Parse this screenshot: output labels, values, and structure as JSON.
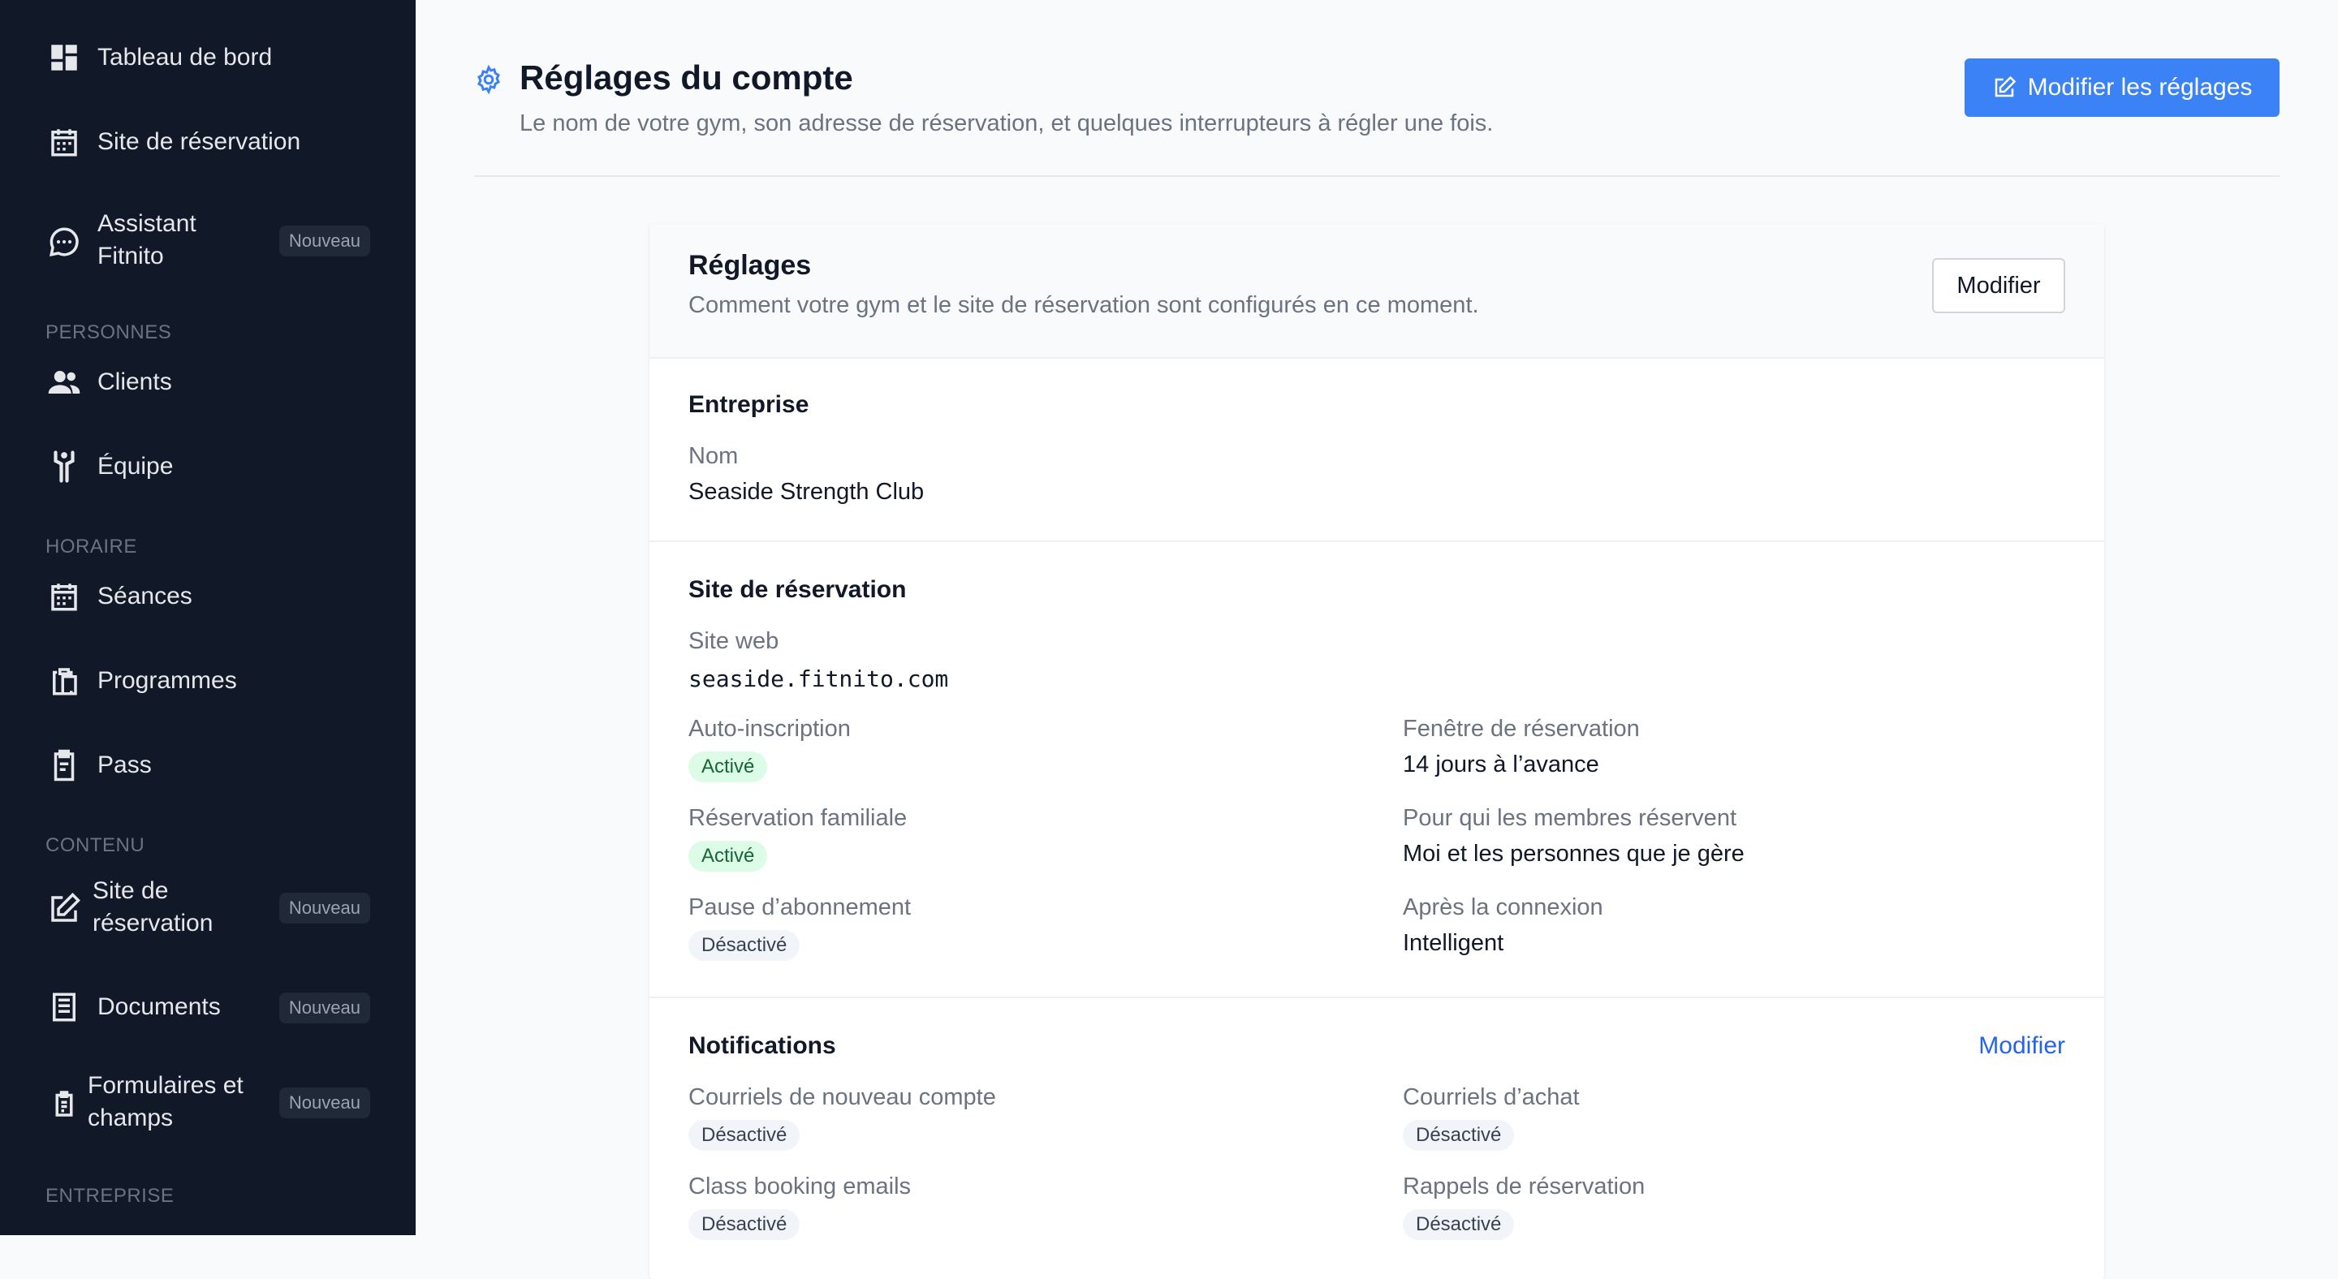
{
  "sidebar": {
    "items": [
      {
        "label": "Tableau de bord",
        "icon": "dashboard-icon"
      },
      {
        "label": "Site de réservation",
        "icon": "calendar-icon"
      },
      {
        "label": "Assistant\nFitnito",
        "icon": "chat-icon",
        "badge": "Nouveau"
      }
    ],
    "sections": [
      {
        "title": "PERSONNES",
        "items": [
          {
            "label": "Clients",
            "icon": "users-icon"
          },
          {
            "label": "Équipe",
            "icon": "person-arms-up-icon"
          }
        ]
      },
      {
        "title": "HORAIRE",
        "items": [
          {
            "label": "Séances",
            "icon": "calendar-icon"
          },
          {
            "label": "Programmes",
            "icon": "clipboard-icon"
          },
          {
            "label": "Pass",
            "icon": "clipboard-list-icon"
          }
        ]
      },
      {
        "title": "CONTENU",
        "items": [
          {
            "label": "Site de\nréservation",
            "icon": "edit-icon",
            "badge": "Nouveau"
          },
          {
            "label": "Documents",
            "icon": "document-icon",
            "badge": "Nouveau"
          },
          {
            "label": "Formulaires et\nchamps",
            "icon": "form-icon",
            "badge": "Nouveau"
          }
        ]
      },
      {
        "title": "ENTREPRISE",
        "items": []
      }
    ]
  },
  "header": {
    "title": "Réglages du compte",
    "subtitle": "Le nom de votre gym, son adresse de réservation, et quelques interrupteurs à régler une fois.",
    "primary_button": "Modifier les réglages"
  },
  "card": {
    "title": "Réglages",
    "description": "Comment votre gym et le site de réservation sont configurés en ce moment.",
    "edit_button": "Modifier",
    "business": {
      "title": "Entreprise",
      "name_label": "Nom",
      "name_value": "Seaside Strength Club"
    },
    "booking_site": {
      "title": "Site de réservation",
      "website_label": "Site web",
      "website_value": "seaside.fitnito.com",
      "self_signup_label": "Auto-inscription",
      "self_signup_value": "Activé",
      "booking_window_label": "Fenêtre de réservation",
      "booking_window_value": "14 jours à l’avance",
      "family_booking_label": "Réservation familiale",
      "family_booking_value": "Activé",
      "members_book_for_label": "Pour qui les membres réservent",
      "members_book_for_value": "Moi et les personnes que je gère",
      "pause_label": "Pause d’abonnement",
      "pause_value": "Désactivé",
      "after_login_label": "Après la connexion",
      "after_login_value": "Intelligent"
    },
    "notifications": {
      "title": "Notifications",
      "edit_link": "Modifier",
      "new_account_label": "Courriels de nouveau compte",
      "new_account_value": "Désactivé",
      "purchase_label": "Courriels d’achat",
      "purchase_value": "Désactivé",
      "class_booking_label": "Class booking emails",
      "class_booking_value": "Désactivé",
      "reminders_label": "Rappels de réservation",
      "reminders_value": "Désactivé"
    }
  },
  "colors": {
    "sidebar_bg": "#111827",
    "accent": "#3b82f6",
    "link": "#2563eb",
    "on_pill_bg": "#dcfce7",
    "on_pill_text": "#166534"
  }
}
